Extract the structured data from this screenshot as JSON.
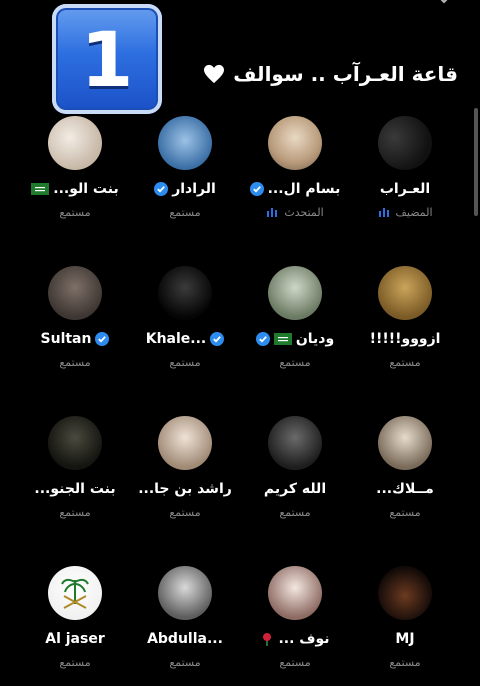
{
  "room": {
    "title": "قاعة العـرآب .. سوالف",
    "badge_number": "1",
    "heart_icon": "white-heart-icon"
  },
  "colors": {
    "accent_blue": "#2d8cf0",
    "badge_blue": "#2d6fe0",
    "muted": "#8a8a8a",
    "flag_green": "#1f7a2e"
  },
  "participants": [
    {
      "name": "العـراب",
      "role": "المضيف",
      "verified": false,
      "flag": false,
      "badge": "bars"
    },
    {
      "name": "بسام ال...",
      "role": "المتحدث",
      "verified": true,
      "flag": false,
      "badge": "bars"
    },
    {
      "name": "الرادار",
      "role": "مستمع",
      "verified": true,
      "flag": false,
      "badge": ""
    },
    {
      "name": "بنت الو...",
      "role": "مستمع",
      "verified": false,
      "flag": true,
      "badge": ""
    },
    {
      "name": "ازووو!!!!!",
      "role": "مستمع",
      "verified": false,
      "flag": false,
      "badge": ""
    },
    {
      "name": "وديان",
      "role": "مستمع",
      "verified": false,
      "flag": true,
      "badge": "verified"
    },
    {
      "name": "Khale...",
      "role": "مستمع",
      "verified": true,
      "flag": false,
      "badge": ""
    },
    {
      "name": "Sultan",
      "role": "مستمع",
      "verified": true,
      "flag": false,
      "badge": ""
    },
    {
      "name": "مــلاك...",
      "role": "مستمع",
      "verified": false,
      "flag": false,
      "badge": ""
    },
    {
      "name": "الله كريم",
      "role": "مستمع",
      "verified": false,
      "flag": false,
      "badge": ""
    },
    {
      "name": "راشد بن جا...",
      "role": "مستمع",
      "verified": false,
      "flag": false,
      "badge": ""
    },
    {
      "name": "بنت الجنو...",
      "role": "مستمع",
      "verified": false,
      "flag": false,
      "badge": ""
    },
    {
      "name": "MJ",
      "role": "مستمع",
      "verified": false,
      "flag": false,
      "badge": ""
    },
    {
      "name": "نوف ...",
      "role": "مستمع",
      "verified": false,
      "flag": false,
      "badge": "rose"
    },
    {
      "name": "Abdulla...",
      "role": "مستمع",
      "verified": false,
      "flag": false,
      "badge": ""
    },
    {
      "name": "Al jaser",
      "role": "مستمع",
      "verified": false,
      "flag": false,
      "badge": ""
    }
  ]
}
